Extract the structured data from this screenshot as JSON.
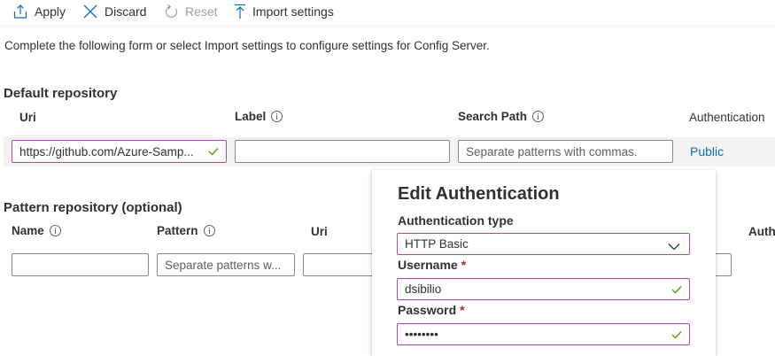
{
  "toolbar": {
    "apply_label": "Apply",
    "discard_label": "Discard",
    "reset_label": "Reset",
    "import_label": "Import settings"
  },
  "intro_text": "Complete the following form or select Import settings to configure settings for Config Server.",
  "default_repo": {
    "title": "Default repository",
    "columns": {
      "uri": "Uri",
      "label": "Label",
      "search_path": "Search Path",
      "authentication": "Authentication"
    },
    "uri_value": "https://github.com/Azure-Samp...",
    "label_value": "",
    "search_path_placeholder": "Separate patterns with commas.",
    "authentication_link": "Public"
  },
  "pattern_repo": {
    "title": "Pattern repository (optional)",
    "columns": {
      "name": "Name",
      "pattern": "Pattern",
      "uri": "Uri",
      "auth_partial": "Auth"
    },
    "pattern_placeholder": "Separate patterns w...",
    "trailing_ellipsis": "..."
  },
  "edit_auth": {
    "title": "Edit Authentication",
    "auth_type_label": "Authentication type",
    "auth_type_value": "HTTP Basic",
    "username_label": "Username",
    "username_value": "dsibilio",
    "password_label": "Password",
    "password_value": "••••••••",
    "required_marker": "*"
  },
  "colors": {
    "accent": "#0f6cbd",
    "focus_border": "#b146c2",
    "valid_check": "#57a300",
    "required": "#a4262c"
  }
}
